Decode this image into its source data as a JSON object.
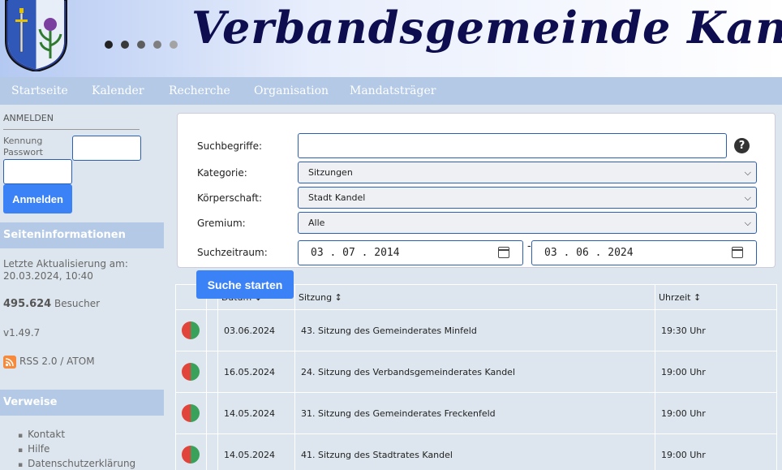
{
  "header": {
    "title": "Verbandsgemeinde Kandel",
    "dot_colors": [
      "#222222",
      "#3a3a3a",
      "#5e5e5e",
      "#7f7f7f",
      "#a3a3a3"
    ]
  },
  "nav": {
    "items": [
      "Startseite",
      "Kalender",
      "Recherche",
      "Organisation",
      "Mandatsträger"
    ]
  },
  "sidebar": {
    "login_heading": "ANMELDEN",
    "kennung_label": "Kennung",
    "passwort_label": "Passwort",
    "login_button": "Anmelden",
    "info_heading": "Seiteninformationen",
    "last_update_label": "Letzte Aktualisierung am:",
    "last_update_value": "20.03.2024, 10:40",
    "visitor_count": "495.624",
    "visitor_label": "Besucher",
    "version": "v1.49.7",
    "rss_text": "RSS 2.0 / ATOM",
    "links_heading": "Verweise",
    "links": [
      "Kontakt",
      "Hilfe",
      "Datenschutzerklärung"
    ]
  },
  "search": {
    "suchbegriffe_label": "Suchbegriffe:",
    "suchbegriffe_value": "",
    "help_icon": "?",
    "kategorie_label": "Kategorie:",
    "kategorie_value": "Sitzungen",
    "koerperschaft_label": "Körperschaft:",
    "koerperschaft_value": "Stadt Kandel",
    "gremium_label": "Gremium:",
    "gremium_value": "Alle",
    "zeitraum_label": "Suchzeitraum:",
    "date_from": "03 . 07 . 2014",
    "date_to": "03 . 06 . 2024",
    "date_separator": "-",
    "submit_label": "Suche starten"
  },
  "table": {
    "headers": [
      "",
      "",
      "Datum ↕",
      "Sitzung ↕",
      "Uhrzeit ↕"
    ],
    "rows": [
      {
        "date": "03.06.2024",
        "title": "43. Sitzung des Gemeinderates Minfeld",
        "time": "19:30 Uhr"
      },
      {
        "date": "16.05.2024",
        "title": "24. Sitzung des Verbandsgemeinderates Kandel",
        "time": "19:00 Uhr"
      },
      {
        "date": "14.05.2024",
        "title": "31. Sitzung des Gemeinderates Freckenfeld",
        "time": "19:00 Uhr"
      },
      {
        "date": "14.05.2024",
        "title": "41. Sitzung des Stadtrates Kandel",
        "time": "19:00 Uhr"
      }
    ]
  }
}
